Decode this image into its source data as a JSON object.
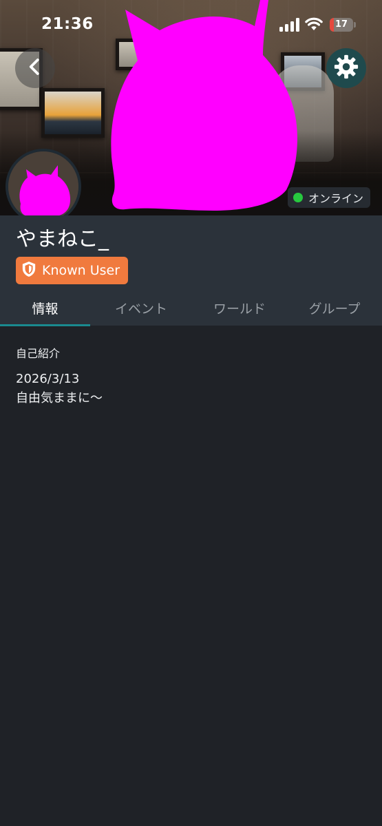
{
  "status_bar": {
    "time": "21:36",
    "battery_level": "17",
    "battery_fraction": 0.17,
    "battery_color": "#e5483d"
  },
  "header": {
    "back_icon": "chevron-left-icon",
    "settings_icon": "gear-icon"
  },
  "profile": {
    "username": "やまねこ_",
    "online_status": "オンライン",
    "online_color": "#27c93f",
    "trust_rank": "Known User",
    "trust_color": "#f07a3e"
  },
  "tabs": [
    {
      "label": "情報",
      "active": true
    },
    {
      "label": "イベント",
      "active": false
    },
    {
      "label": "ワールド",
      "active": false
    },
    {
      "label": "グループ",
      "active": false
    }
  ],
  "info": {
    "section_title": "自己紹介",
    "bio": "2026/3/13\n自由気ままに〜"
  },
  "colors": {
    "censor": "#ff00ff",
    "tab_indicator": "#1a8a8f",
    "background": "#1f2227",
    "header_panel": "#2b323a"
  }
}
